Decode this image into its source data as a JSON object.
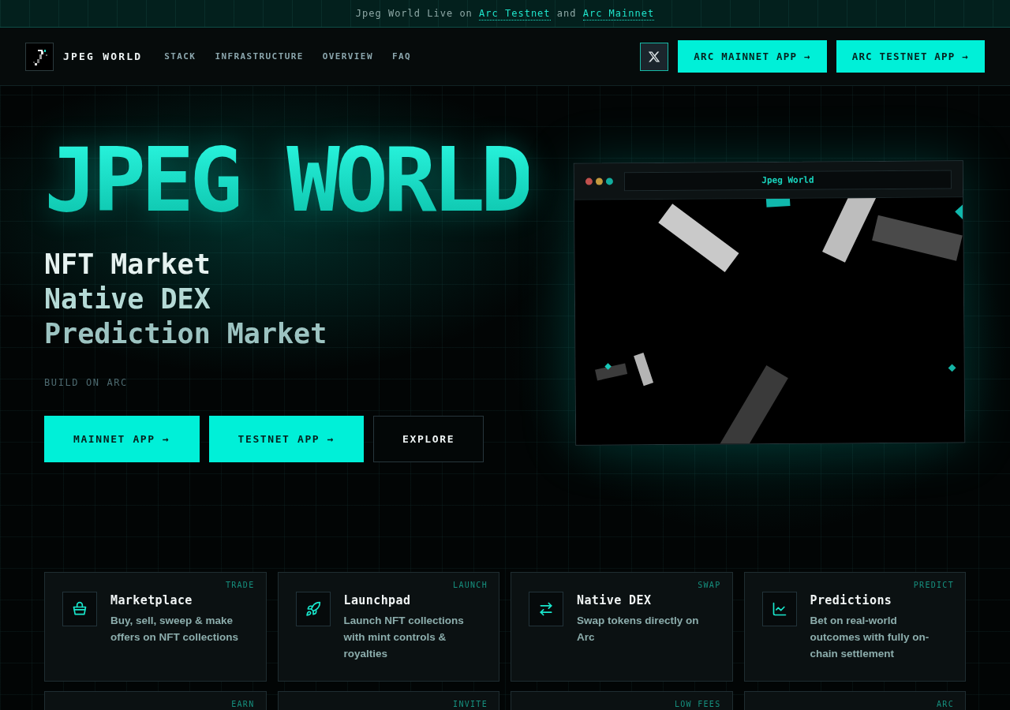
{
  "banner": {
    "parts": [
      {
        "kind": "text",
        "text": "Jpeg World Live on"
      },
      {
        "kind": "link",
        "text": "Arc Testnet"
      },
      {
        "kind": "text",
        "text": "and"
      },
      {
        "kind": "link",
        "text": "Arc Mainnet"
      }
    ]
  },
  "nav": {
    "brand": "JPEG WORLD",
    "links": [
      "STACK",
      "INFRASTRUCTURE",
      "OVERVIEW",
      "FAQ"
    ],
    "buttons": [
      "ARC MAINNET APP →",
      "ARC TESTNET APP →"
    ]
  },
  "hero": {
    "title": "JPEG WORLD",
    "lines": [
      "NFT Market",
      "Native DEX",
      "Prediction Market"
    ],
    "tagline": "BUILD ON ARC",
    "buttons": [
      {
        "kind": "primary",
        "label": "MAINNET APP →"
      },
      {
        "kind": "primary",
        "label": "TESTNET APP →"
      },
      {
        "kind": "outline",
        "label": "EXPLORE"
      }
    ]
  },
  "preview": {
    "address": "Jpeg World"
  },
  "features": [
    {
      "kind": "marketplace",
      "tag": "TRADE",
      "title": "Marketplace",
      "description": "Buy, sell, sweep & make offers on NFT collections"
    },
    {
      "kind": "launchpad",
      "tag": "LAUNCH",
      "title": "Launchpad",
      "description": "Launch NFT collections with mint controls & royalties"
    },
    {
      "kind": "dex",
      "tag": "SWAP",
      "title": "Native DEX",
      "description": "Swap tokens directly on Arc"
    },
    {
      "kind": "predictions",
      "tag": "PREDICT",
      "title": "Predictions",
      "description": "Bet on real-world outcomes with fully on-chain settlement"
    },
    {
      "tag": "EARN"
    },
    {
      "tag": "INVITE"
    },
    {
      "tag": "LOW FEES"
    },
    {
      "tag": "ARC"
    }
  ]
}
